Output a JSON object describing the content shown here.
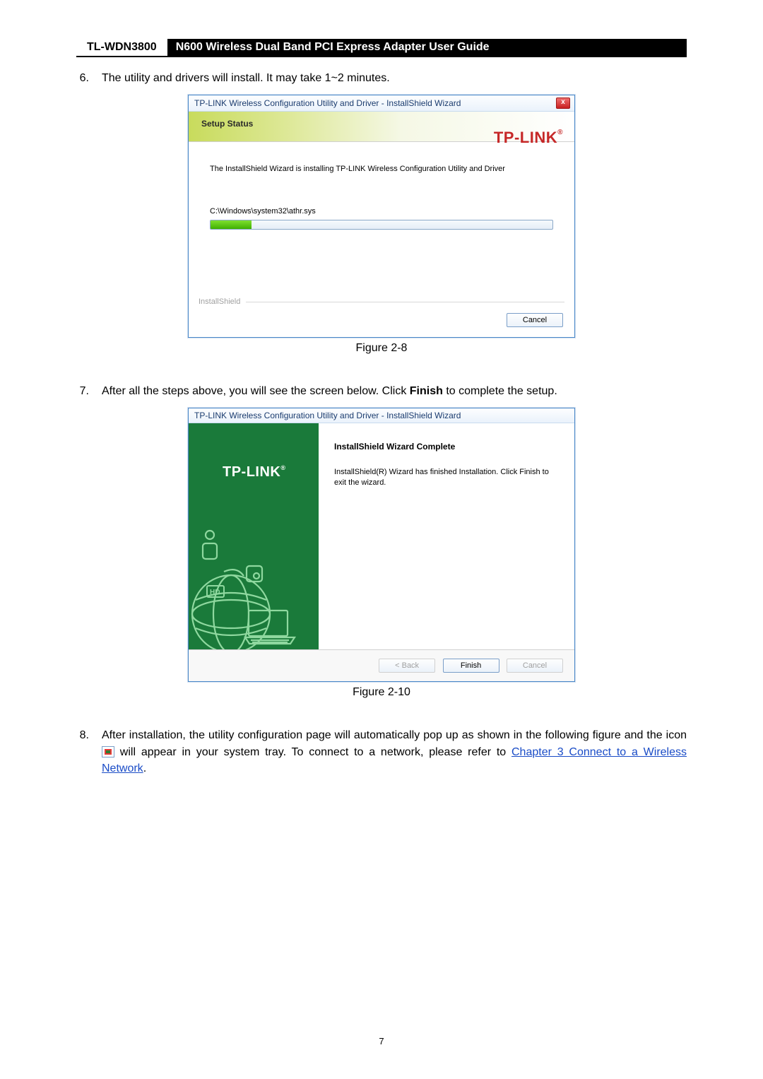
{
  "header": {
    "model": "TL-WDN3800",
    "title": "N600 Wireless Dual Band PCI Express Adapter User Guide"
  },
  "step6": {
    "num": "6.",
    "text": "The utility and drivers will install. It may take 1~2 minutes."
  },
  "win1": {
    "title": "TP-LINK Wireless Configuration Utility and Driver - InstallShield Wizard",
    "close": "x",
    "setup_status": "Setup Status",
    "brand": "TP-LINK",
    "installing": "The InstallShield Wizard is installing TP-LINK Wireless Configuration Utility and Driver",
    "path": "C:\\Windows\\system32\\athr.sys",
    "progress_percent": 12,
    "shield": "InstallShield",
    "cancel": "Cancel"
  },
  "caption1": "Figure 2-8",
  "step7": {
    "num": "7.",
    "pre": "After all the steps above, you will see the screen below. Click ",
    "bold": "Finish",
    "post": " to complete the setup."
  },
  "win2": {
    "title": "TP-LINK Wireless Configuration Utility and Driver - InstallShield Wizard",
    "brand": "TP-LINK",
    "hd": "HD",
    "heading": "InstallShield Wizard Complete",
    "text": "InstallShield(R) Wizard has finished Installation. Click Finish to exit the wizard.",
    "back": "< Back",
    "finish": "Finish",
    "cancel": "Cancel"
  },
  "caption2": "Figure 2-10",
  "step8": {
    "num": "8.",
    "pre": "After installation, the utility configuration page will automatically pop up as shown in the following figure and the icon ",
    "mid": " will appear in your system tray. To connect to a network, please refer to ",
    "link": "Chapter 3 Connect to a Wireless Network",
    "post": "."
  },
  "page_number": "7"
}
